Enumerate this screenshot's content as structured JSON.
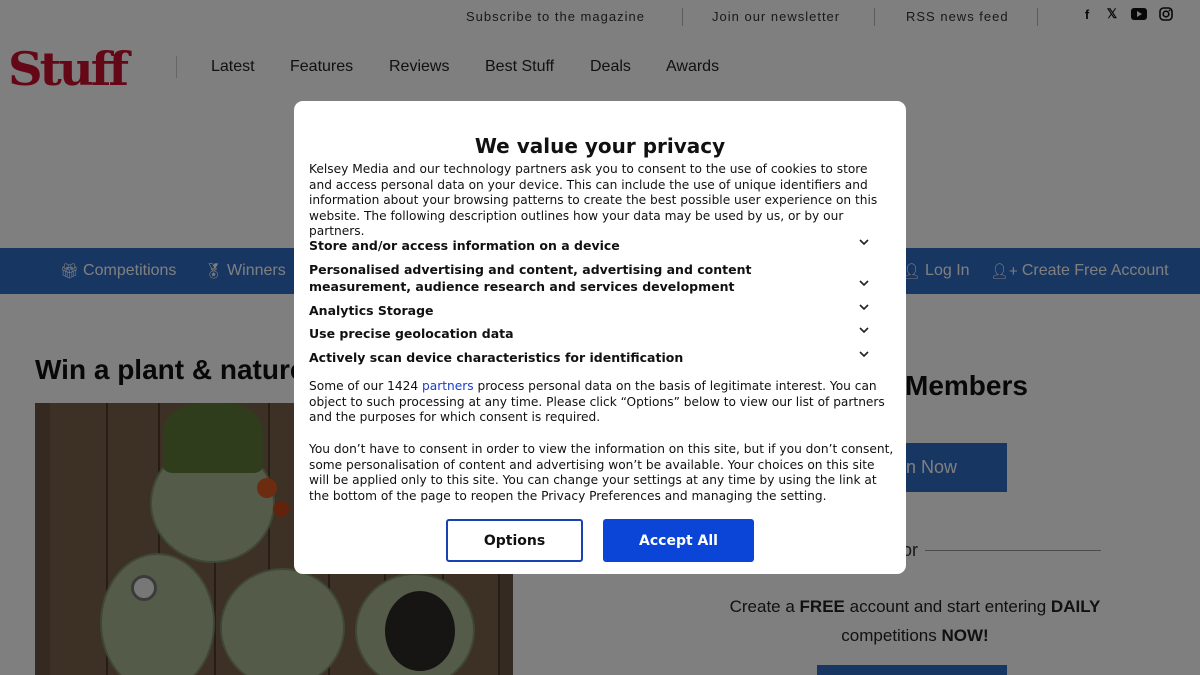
{
  "utility_links": [
    "Subscribe to the magazine",
    "Join our newsletter",
    "RSS news feed"
  ],
  "social_icons": [
    "facebook-icon",
    "x-icon",
    "youtube-icon",
    "instagram-icon"
  ],
  "logo_text": "Stuff",
  "nav": [
    "Latest",
    "Features",
    "Reviews",
    "Best Stuff",
    "Deals",
    "Awards"
  ],
  "secondary_nav": {
    "competitions": "Competitions",
    "winners": "Winners",
    "login": "Log In",
    "create_account": "Create Free Account"
  },
  "page": {
    "title": "Win a plant & nature",
    "members_title": "Members",
    "join_button": "n Now",
    "or": "or",
    "create_text_parts": [
      "Create a ",
      "FREE",
      " account and start entering ",
      "DAILY",
      " competitions ",
      "NOW!"
    ]
  },
  "modal": {
    "title": "We value your privacy",
    "intro": "Kelsey Media and our technology partners ask you to consent to the use of cookies to store and access personal data on your device. This can include the use of unique identifiers and information about your browsing patterns to create the best possible user experience on this website. The following description outlines how your data may be used by us, or by our partners.",
    "purposes": [
      "Store and/or access information on a device",
      "Personalised advertising and content, advertising and content measurement, audience research and services development",
      "Analytics Storage",
      "Use precise geolocation data",
      "Actively scan device characteristics for identification"
    ],
    "legit_interest_before": "Some of our 1424 ",
    "legit_interest_link": "partners",
    "legit_interest_after": " process personal data on the basis of legitimate interest. You can object to such processing at any time. Please click “Options” below to view our list of partners and the purposes for which consent is required.",
    "consent_note": "You don’t have to consent in order to view the information on this site, but if you don’t consent, some personalisation of content and advertising won’t be available. Your choices on this site will be applied only to this site. You can change your settings at any time by using the link at the bottom of the page to reopen the Privacy Preferences and managing the setting.",
    "options_label": "Options",
    "accept_label": "Accept All"
  },
  "colors": {
    "brand_red": "#c8102e",
    "nav_blue": "#2f6cc4",
    "accept_blue": "#0a45d8"
  }
}
